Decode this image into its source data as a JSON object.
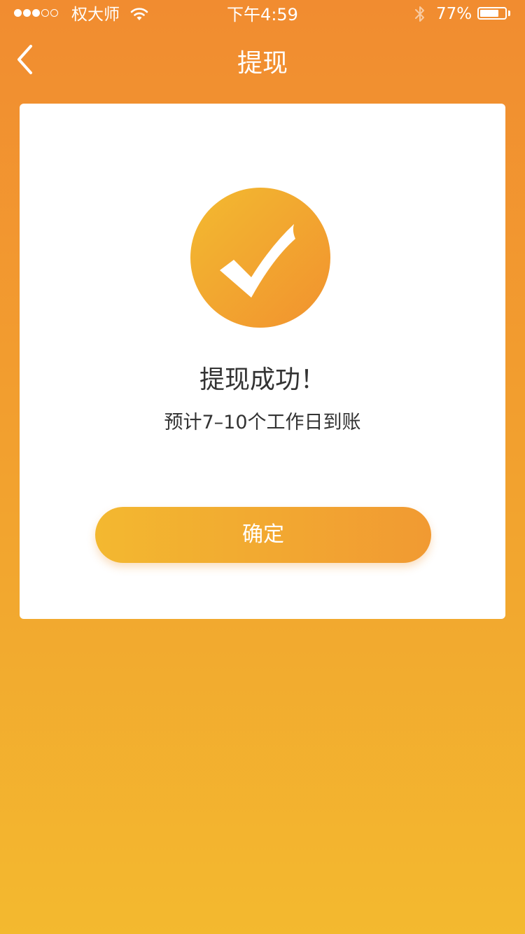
{
  "status_bar": {
    "signal_bars": 3,
    "signal_total": 5,
    "carrier": "权大师",
    "wifi_icon": "wifi-icon",
    "time": "下午4:59",
    "bluetooth_icon": "bluetooth-icon",
    "battery_percent": "77%",
    "battery_level": 0.77
  },
  "nav": {
    "back_icon": "chevron-left-icon",
    "title": "提现"
  },
  "result": {
    "icon": "checkmark-circle-icon",
    "title": "提现成功！",
    "subtitle": "预计7–10个工作日到账"
  },
  "actions": {
    "confirm_label": "确定"
  },
  "colors": {
    "background_top": "#f18c30",
    "background_bottom": "#f3b92f",
    "accent_start": "#f3b830",
    "accent_end": "#f19a32",
    "text_primary": "#333333",
    "card": "#ffffff"
  }
}
